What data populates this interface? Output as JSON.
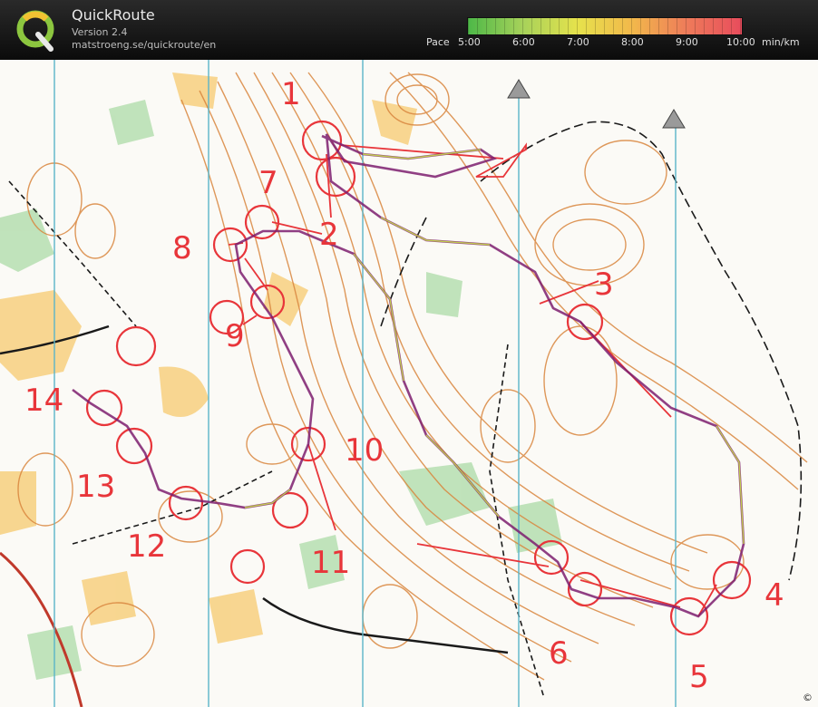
{
  "app": {
    "name": "QuickRoute",
    "version": "Version 2.4",
    "url": "matstroeng.se/quickroute/en"
  },
  "pace_legend": {
    "label": "Pace",
    "ticks": [
      "5:00",
      "6:00",
      "7:00",
      "8:00",
      "9:00",
      "10:00"
    ],
    "unit": "min/km",
    "color_stops": [
      "#4db848",
      "#a7d25a",
      "#e6e24c",
      "#f2b84b",
      "#ee7b5a",
      "#e84c5c"
    ]
  },
  "map": {
    "control_numbers": [
      "1",
      "2",
      "3",
      "4",
      "5",
      "6",
      "7",
      "8",
      "9",
      "10",
      "11",
      "12",
      "13",
      "14"
    ],
    "copyright_mark": "©"
  }
}
